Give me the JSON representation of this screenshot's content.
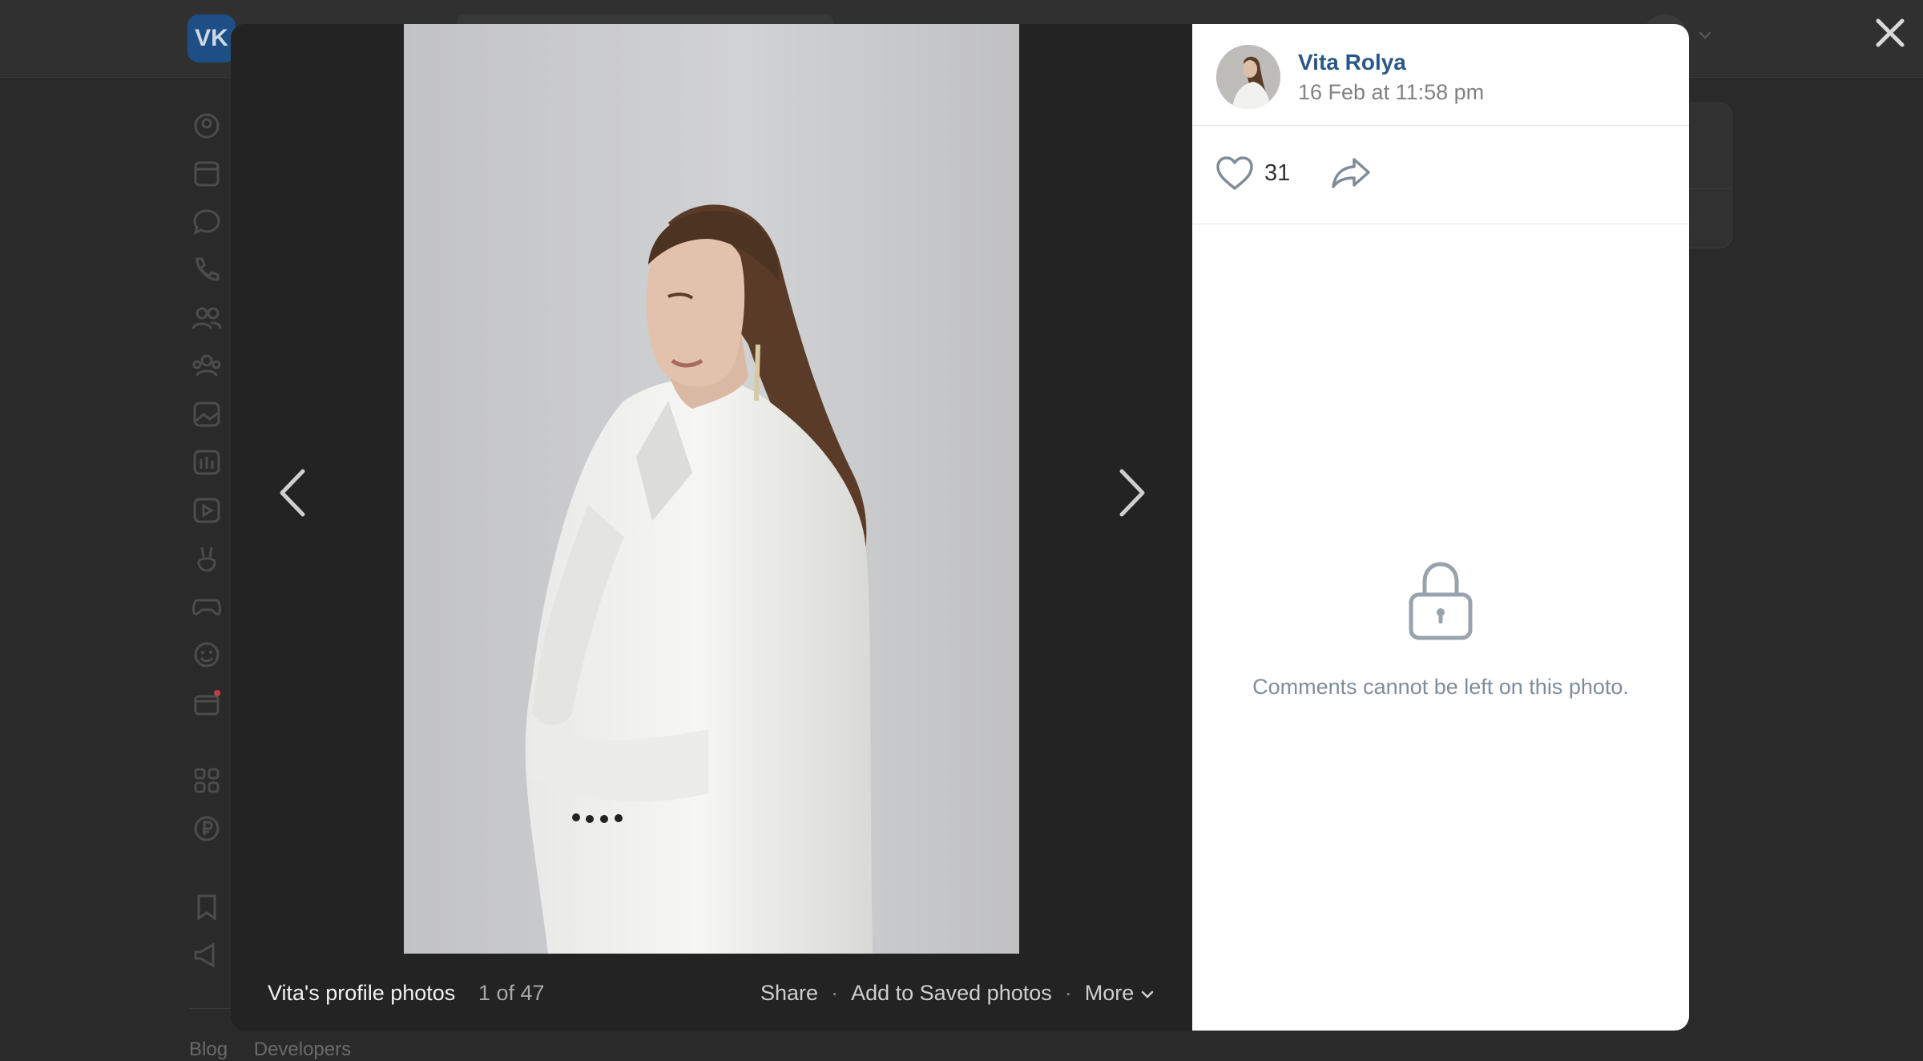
{
  "background": {
    "logo_text": "VK",
    "footer_links": [
      "Blog",
      "Developers"
    ]
  },
  "viewer": {
    "album_title": "Vita's profile photos",
    "counter": "1 of 47",
    "actions": {
      "share": "Share",
      "add_saved": "Add to Saved photos",
      "more": "More"
    }
  },
  "post": {
    "author": "Vita Rolya",
    "date": "16 Feb at 11:58 pm",
    "likes": "31",
    "comments_disabled_text": "Comments cannot be left on this photo."
  },
  "colors": {
    "link": "#2a5885",
    "muted": "#818c99",
    "overlay": "#2a2a2a"
  },
  "icons": {
    "like": "heart-icon",
    "share": "share-arrow-icon",
    "lock": "lock-icon",
    "close": "close-icon",
    "prev": "chevron-left-icon",
    "next": "chevron-right-icon"
  }
}
